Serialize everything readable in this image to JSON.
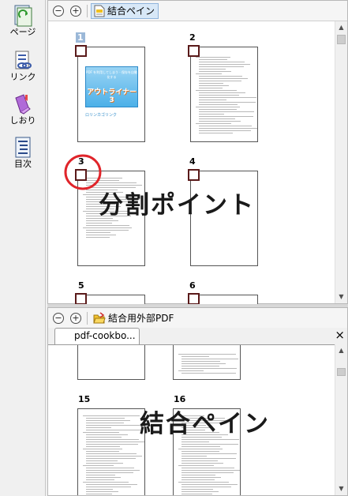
{
  "sidebar": {
    "items": [
      {
        "label": "ページ",
        "icon": "pages-icon"
      },
      {
        "label": "リンク",
        "icon": "link-icon"
      },
      {
        "label": "しおり",
        "icon": "bookmark-icon"
      },
      {
        "label": "目次",
        "icon": "toc-icon"
      }
    ]
  },
  "top_pane": {
    "toolbar": {
      "zoom_out": "−",
      "zoom_in": "+",
      "tab_label": "結合ペイン"
    },
    "pages": [
      {
        "number": "1",
        "selected": true
      },
      {
        "number": "2"
      },
      {
        "number": "3"
      },
      {
        "number": "4"
      },
      {
        "number": "5"
      },
      {
        "number": "6"
      }
    ],
    "cover_title": "アウトライナー3",
    "cover_header": "PDF を利用してしまう - 保存を自動化する",
    "cover_footer": "ロリンカゴリンク",
    "overlay_label": "分割ポイント"
  },
  "bottom_pane": {
    "toolbar": {
      "zoom_out": "−",
      "zoom_in": "+",
      "tab_label": "結合用外部PDF"
    },
    "doc_tab": "pdf-cookbo...",
    "close": "×",
    "pages": [
      {
        "number": "15"
      },
      {
        "number": "16"
      }
    ],
    "overlay_label": "結合ペイン"
  },
  "scroll": {
    "up": "▲",
    "down": "▼"
  },
  "colors": {
    "selection_blue": "#9bb8d8",
    "split_box": "#5a1a1a",
    "highlight_circle": "#e0242a",
    "cover_blue": "#3aa8e0"
  }
}
